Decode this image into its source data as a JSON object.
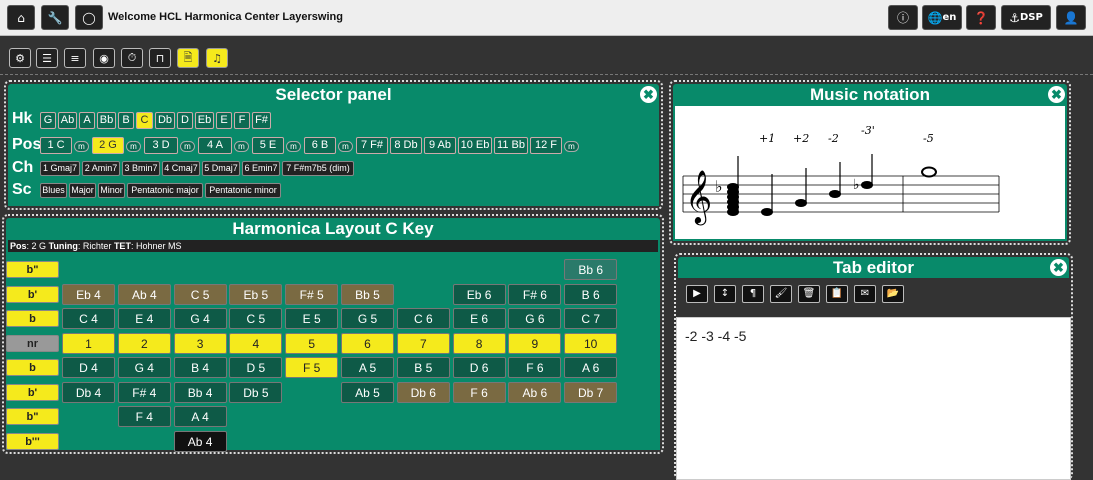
{
  "topbar": {
    "welcome": "Welcome HCL Harmonica Center Layerswing",
    "lang_label": "en",
    "dsp_label": "DSP"
  },
  "selector": {
    "title": "Selector panel",
    "hk_label": "Hk",
    "pos_label": "Pos",
    "ch_label": "Ch",
    "sc_label": "Sc",
    "keys": [
      "G",
      "Ab",
      "A",
      "Bb",
      "B",
      "C",
      "Db",
      "D",
      "Eb",
      "E",
      "F",
      "F#"
    ],
    "selected_key": "C",
    "positions": [
      "1 C",
      "2 G",
      "3 D",
      "4 A",
      "5 E",
      "6 B",
      "7 F#",
      "8 Db",
      "9 Ab",
      "10 Eb",
      "11 Bb",
      "12 F"
    ],
    "m_label": "m",
    "selected_position": "2 G",
    "chords": [
      "1 Gmaj7",
      "2 Amin7",
      "3 Bmin7",
      "4 Cmaj7",
      "5 Dmaj7",
      "6 Emin7",
      "7 F#m7b5 (dim)"
    ],
    "scales": [
      "Blues",
      "Major",
      "Minor",
      "Pentatonic major",
      "Pentatonic minor"
    ]
  },
  "layout": {
    "title": "Harmonica Layout C Key",
    "info": {
      "pos_label": "Pos",
      "pos_value": "2 G",
      "tuning_label": "Tuning",
      "tuning_value": "Richter",
      "tet_label": "TET",
      "tet_value": "Hohner MS"
    },
    "rows": [
      {
        "label": "b\"",
        "cells": [
          "",
          "",
          "",
          "",
          "",
          "",
          "",
          "",
          "",
          "Bb 6"
        ]
      },
      {
        "label": "b'",
        "cells": [
          "Eb 4",
          "Ab 4",
          "C 5",
          "Eb 5",
          "F# 5",
          "Bb 5",
          "",
          "Eb 6",
          "F# 6",
          "B 6"
        ]
      },
      {
        "label": "b",
        "cells": [
          "C 4",
          "E 4",
          "G 4",
          "C 5",
          "E 5",
          "G 5",
          "C 6",
          "E 6",
          "G 6",
          "C 7"
        ]
      },
      {
        "label": "nr",
        "cells": [
          "1",
          "2",
          "3",
          "4",
          "5",
          "6",
          "7",
          "8",
          "9",
          "10"
        ]
      },
      {
        "label": "b",
        "cells": [
          "D 4",
          "G 4",
          "B 4",
          "D 5",
          "F 5",
          "A 5",
          "B 5",
          "D 6",
          "F 6",
          "A 6"
        ]
      },
      {
        "label": "b'",
        "cells": [
          "Db 4",
          "F# 4",
          "Bb 4",
          "Db 5",
          "",
          "Ab 5",
          "Db 6",
          "F 6",
          "Ab 6",
          "Db 7"
        ]
      },
      {
        "label": "b\"",
        "cells": [
          "",
          "F 4",
          "A 4",
          "",
          "",
          "",
          "",
          "",
          "",
          ""
        ]
      },
      {
        "label": "b'''",
        "cells": [
          "",
          "",
          "Ab 4",
          "",
          "",
          "",
          "",
          "",
          "",
          ""
        ]
      }
    ]
  },
  "notation": {
    "title": "Music notation",
    "labels": [
      "+1",
      "+2",
      "-2",
      "-3'",
      "-5"
    ]
  },
  "tab_editor": {
    "title": "Tab editor",
    "text": "-2 -3 -4 -5"
  }
}
